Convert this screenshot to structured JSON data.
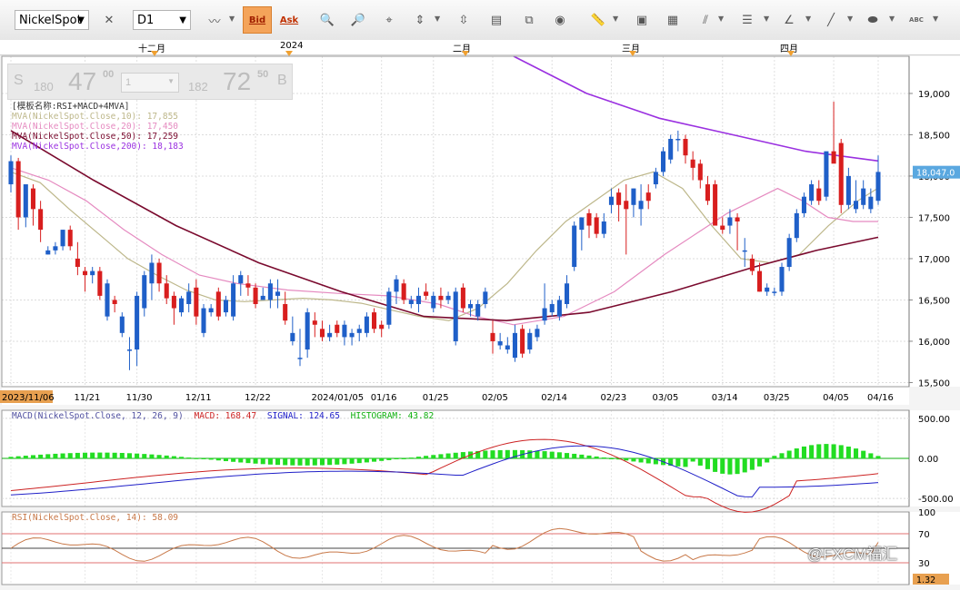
{
  "toolbar": {
    "symbol": "NickelSpot",
    "timeframe": "D1",
    "bid_label": "Bid",
    "ask_label": "Ask",
    "abc_label": "ABC"
  },
  "months": [
    "十二月",
    "2024",
    "二月",
    "三月",
    "四月"
  ],
  "quote": {
    "sell_letter": "S",
    "sell_prefix": "180",
    "sell_big": "47",
    "sell_small": "00",
    "lots": "1",
    "buy_prefix": "182",
    "buy_big": "72",
    "buy_small": "50",
    "buy_letter": "B"
  },
  "legend_main": [
    {
      "text": "[模板名称:RSI+MACD+4MVA]",
      "color": "#333333"
    },
    {
      "text": "MVA(NickelSpot.Close,10): 17,855",
      "color": "#bdb78a"
    },
    {
      "text": "MVA(NickelSpot.Close,20): 17,450",
      "color": "#e58ac0"
    },
    {
      "text": "MVA(NickelSpot.Close,50): 17,259",
      "color": "#7a0a2e"
    },
    {
      "text": "MVA(NickelSpot.Close,200): 18,183",
      "color": "#9a30e0"
    }
  ],
  "legend_macd": [
    {
      "text": "MACD(NickelSpot.Close, 12, 26, 9)",
      "color": "#5050a0"
    },
    {
      "text": "MACD: 168.47",
      "color": "#cc2222"
    },
    {
      "text": "SIGNAL: 124.65",
      "color": "#2020c8"
    },
    {
      "text": "HISTOGRAM: 43.82",
      "color": "#10b010"
    }
  ],
  "legend_rsi": [
    {
      "text": "RSI(NickelSpot.Close, 14): 58.09",
      "color": "#c87848"
    }
  ],
  "price_axis": [
    "19,000",
    "18,500",
    "18,000",
    "17,500",
    "17,000",
    "16,500",
    "16,000",
    "15,500"
  ],
  "macd_axis": [
    "500.00",
    "0.00",
    "-500.00"
  ],
  "rsi_axis": [
    "100",
    "70",
    "30"
  ],
  "last_price_label": "18,047.0",
  "rsi_last_label": "1.32",
  "date_highlight": "2023/11/06",
  "watermark": "@FXCM福汇",
  "chart_data": {
    "type": "candlestick",
    "symbol": "NickelSpot",
    "timeframe": "D1",
    "x_labels": [
      "2023/11/06",
      "11/21",
      "11/30",
      "12/11",
      "12/22",
      "2024/01/05",
      "01/16",
      "01/25",
      "02/05",
      "02/14",
      "02/23",
      "03/05",
      "03/14",
      "03/25",
      "04/05",
      "04/16"
    ],
    "ylim": [
      15450,
      19450
    ],
    "colors": {
      "up": "#1f5fc8",
      "down": "#d81e1e",
      "ma10": "#bdb78a",
      "ma20": "#e58ac0",
      "ma50": "#7a0a2e",
      "ma200": "#9a30e0"
    },
    "candles": [
      [
        17900,
        18250,
        17800,
        18180
      ],
      [
        18180,
        18220,
        17350,
        17500
      ],
      [
        17500,
        17650,
        17380,
        17900
      ],
      [
        17850,
        17900,
        17400,
        17600
      ],
      [
        17600,
        17700,
        17200,
        17350
      ],
      [
        17050,
        17150,
        17050,
        17100
      ],
      [
        17100,
        17200,
        17050,
        17150
      ],
      [
        17150,
        17350,
        17100,
        17350
      ],
      [
        17350,
        17400,
        17100,
        17150
      ],
      [
        17000,
        17200,
        16800,
        16900
      ],
      [
        16850,
        16900,
        16600,
        16800
      ],
      [
        16800,
        16900,
        16700,
        16850
      ],
      [
        16850,
        16900,
        16500,
        16550
      ],
      [
        16300,
        16750,
        16250,
        16700
      ],
      [
        16500,
        16550,
        16350,
        16450
      ],
      [
        16100,
        16350,
        16050,
        16300
      ],
      [
        15900,
        16050,
        15650,
        15900
      ],
      [
        15900,
        16600,
        15700,
        16550
      ],
      [
        16400,
        16850,
        16300,
        16800
      ],
      [
        16700,
        17050,
        16500,
        16950
      ],
      [
        16950,
        17000,
        16600,
        16700
      ],
      [
        16700,
        16800,
        16450,
        16520
      ],
      [
        16550,
        16600,
        16200,
        16400
      ],
      [
        16350,
        16550,
        16300,
        16520
      ],
      [
        16450,
        16700,
        16350,
        16600
      ],
      [
        16650,
        16750,
        16200,
        16300
      ],
      [
        16100,
        16450,
        16050,
        16400
      ],
      [
        16350,
        16450,
        16300,
        16400
      ],
      [
        16600,
        16650,
        16250,
        16300
      ],
      [
        16350,
        16550,
        16300,
        16500
      ],
      [
        16300,
        16800,
        16250,
        16700
      ],
      [
        16700,
        16850,
        16550,
        16800
      ],
      [
        16700,
        16800,
        16550,
        16650
      ],
      [
        16650,
        16700,
        16400,
        16450
      ],
      [
        16500,
        16650,
        16500,
        16550
      ],
      [
        16500,
        16750,
        16400,
        16700
      ],
      [
        16550,
        16750,
        16400,
        16600
      ],
      [
        16450,
        16600,
        16200,
        16250
      ],
      [
        16000,
        16300,
        15950,
        16100
      ],
      [
        15800,
        16150,
        15700,
        15800
      ],
      [
        15900,
        16400,
        15800,
        16350
      ],
      [
        16250,
        16350,
        16050,
        16200
      ],
      [
        16150,
        16250,
        16000,
        16050
      ],
      [
        16050,
        16200,
        16000,
        16100
      ],
      [
        16200,
        16250,
        16050,
        16100
      ],
      [
        16050,
        16250,
        15950,
        16200
      ],
      [
        16050,
        16150,
        15950,
        16100
      ],
      [
        16100,
        16200,
        16000,
        16150
      ],
      [
        16100,
        16350,
        16050,
        16300
      ],
      [
        16350,
        16400,
        16100,
        16150
      ],
      [
        16200,
        16250,
        16050,
        16150
      ],
      [
        16200,
        16650,
        16150,
        16600
      ],
      [
        16600,
        16800,
        16450,
        16750
      ],
      [
        16700,
        16750,
        16450,
        16500
      ],
      [
        16450,
        16550,
        16400,
        16500
      ],
      [
        16450,
        16650,
        16350,
        16550
      ],
      [
        16600,
        16700,
        16500,
        16550
      ],
      [
        16400,
        16600,
        16350,
        16550
      ],
      [
        16550,
        16650,
        16400,
        16500
      ],
      [
        16500,
        16600,
        16450,
        16550
      ],
      [
        16000,
        16650,
        15950,
        16600
      ],
      [
        16650,
        16700,
        16350,
        16400
      ],
      [
        16400,
        16500,
        16300,
        16450
      ],
      [
        16300,
        16500,
        16250,
        16450
      ],
      [
        16450,
        16650,
        16400,
        16600
      ],
      [
        16100,
        16250,
        15850,
        16000
      ],
      [
        15950,
        16100,
        15900,
        16000
      ],
      [
        15900,
        16050,
        15850,
        15950
      ],
      [
        15800,
        16200,
        15750,
        16100
      ],
      [
        16150,
        16200,
        15800,
        15850
      ],
      [
        15900,
        16150,
        15850,
        16100
      ],
      [
        16050,
        16200,
        16000,
        16150
      ],
      [
        16250,
        16700,
        16200,
        16400
      ],
      [
        16350,
        16500,
        16300,
        16450
      ],
      [
        16300,
        16550,
        16250,
        16500
      ],
      [
        16450,
        16800,
        16400,
        16700
      ],
      [
        16900,
        17450,
        16850,
        17400
      ],
      [
        17350,
        17500,
        17100,
        17500
      ],
      [
        17550,
        17600,
        17250,
        17400
      ],
      [
        17500,
        17550,
        17250,
        17300
      ],
      [
        17300,
        17550,
        17250,
        17450
      ],
      [
        17650,
        17850,
        17550,
        17750
      ],
      [
        17800,
        17850,
        17450,
        17650
      ],
      [
        17700,
        17900,
        17050,
        17600
      ],
      [
        17650,
        17850,
        17500,
        17850
      ],
      [
        17600,
        17900,
        17400,
        17700
      ],
      [
        17800,
        17900,
        17600,
        17700
      ],
      [
        17900,
        18100,
        17850,
        18050
      ],
      [
        18050,
        18350,
        18000,
        18300
      ],
      [
        18200,
        18500,
        18150,
        18450
      ],
      [
        18450,
        18550,
        18300,
        18450
      ],
      [
        18450,
        18500,
        18150,
        18250
      ],
      [
        18200,
        18300,
        17950,
        18100
      ],
      [
        18150,
        18200,
        17850,
        17950
      ],
      [
        17900,
        18000,
        17650,
        17700
      ],
      [
        17900,
        17950,
        17500,
        17400
      ],
      [
        17400,
        17500,
        17300,
        17350
      ],
      [
        17400,
        17600,
        17300,
        17500
      ],
      [
        17500,
        17550,
        17100,
        17450
      ],
      [
        17100,
        17250,
        16900,
        17100
      ],
      [
        17000,
        17050,
        16800,
        16850
      ],
      [
        16850,
        16950,
        16600,
        16600
      ],
      [
        16600,
        16700,
        16550,
        16650
      ],
      [
        16600,
        16650,
        16550,
        16600
      ],
      [
        16600,
        16950,
        16550,
        16900
      ],
      [
        16900,
        17300,
        16850,
        17250
      ],
      [
        17250,
        17600,
        17200,
        17550
      ],
      [
        17550,
        17800,
        17500,
        17750
      ],
      [
        17700,
        17950,
        17650,
        17900
      ],
      [
        17850,
        17950,
        17650,
        17700
      ],
      [
        17750,
        18150,
        17700,
        18300
      ],
      [
        18300,
        18900,
        18200,
        18150
      ],
      [
        18400,
        18450,
        17550,
        17650
      ],
      [
        17650,
        18100,
        17600,
        18000
      ],
      [
        17600,
        17950,
        17550,
        17700
      ],
      [
        17650,
        17950,
        17600,
        17850
      ],
      [
        17600,
        17850,
        17550,
        17750
      ],
      [
        17700,
        18250,
        17650,
        18050
      ]
    ],
    "ma10": [
      [
        0,
        18050
      ],
      [
        10,
        17920
      ],
      [
        20,
        17600
      ],
      [
        30,
        17300
      ],
      [
        40,
        17000
      ],
      [
        50,
        16800
      ],
      [
        60,
        16620
      ],
      [
        70,
        16500
      ],
      [
        80,
        16480
      ],
      [
        90,
        16500
      ],
      [
        100,
        16520
      ],
      [
        110,
        16500
      ],
      [
        120,
        16460
      ],
      [
        130,
        16380
      ],
      [
        140,
        16300
      ],
      [
        150,
        16250
      ],
      [
        160,
        16400
      ],
      [
        170,
        16700
      ],
      [
        180,
        17100
      ],
      [
        190,
        17450
      ],
      [
        200,
        17700
      ],
      [
        210,
        17950
      ],
      [
        220,
        18050
      ],
      [
        230,
        17850
      ],
      [
        240,
        17400
      ],
      [
        250,
        17000
      ],
      [
        260,
        16950
      ],
      [
        270,
        17050
      ],
      [
        280,
        17400
      ],
      [
        290,
        17700
      ],
      [
        297,
        17855
      ]
    ],
    "ma20": [
      [
        0,
        18100
      ],
      [
        15,
        17950
      ],
      [
        30,
        17700
      ],
      [
        45,
        17350
      ],
      [
        60,
        17050
      ],
      [
        75,
        16800
      ],
      [
        90,
        16700
      ],
      [
        110,
        16620
      ],
      [
        130,
        16580
      ],
      [
        150,
        16550
      ],
      [
        170,
        16450
      ],
      [
        185,
        16300
      ],
      [
        200,
        16200
      ],
      [
        220,
        16300
      ],
      [
        240,
        16600
      ],
      [
        260,
        17050
      ],
      [
        275,
        17350
      ],
      [
        285,
        17550
      ],
      [
        295,
        17700
      ],
      [
        305,
        17850
      ],
      [
        315,
        17700
      ],
      [
        325,
        17500
      ],
      [
        335,
        17450
      ],
      [
        345,
        17450
      ]
    ],
    "ma50": [
      [
        0,
        18550
      ],
      [
        40,
        17950
      ],
      [
        80,
        17400
      ],
      [
        120,
        16950
      ],
      [
        160,
        16600
      ],
      [
        200,
        16300
      ],
      [
        240,
        16250
      ],
      [
        280,
        16350
      ],
      [
        320,
        16600
      ],
      [
        360,
        16900
      ],
      [
        390,
        17100
      ],
      [
        420,
        17259
      ]
    ],
    "ma200": [
      [
        0,
        19450
      ],
      [
        40,
        19000
      ],
      [
        80,
        18700
      ],
      [
        120,
        18500
      ],
      [
        160,
        18300
      ],
      [
        200,
        18183
      ]
    ],
    "macd": {
      "ylim": [
        -600,
        600
      ],
      "last_macd": 168.47,
      "last_signal": 124.65,
      "last_histogram": 43.82
    },
    "rsi": {
      "levels": [
        30,
        70
      ],
      "ylim": [
        0,
        100
      ],
      "last": 58.09
    }
  }
}
